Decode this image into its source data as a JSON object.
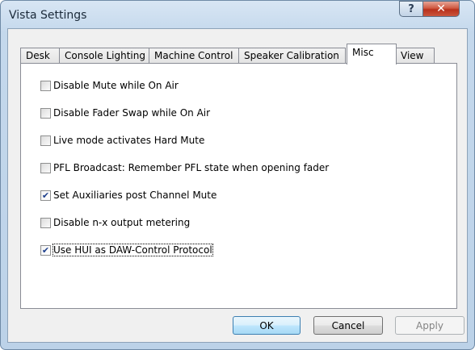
{
  "window": {
    "title": "Vista Settings",
    "help_label": "?",
    "close_label": "✕"
  },
  "tabs": [
    {
      "label": "Desk"
    },
    {
      "label": "Console Lighting"
    },
    {
      "label": "Machine Control"
    },
    {
      "label": "Speaker Calibration"
    },
    {
      "label": "Misc"
    },
    {
      "label": "View"
    }
  ],
  "active_tab": "Misc",
  "options": [
    {
      "label": "Disable Mute while On Air",
      "checked": false
    },
    {
      "label": "Disable Fader Swap while On Air",
      "checked": false
    },
    {
      "label": "Live mode activates Hard Mute",
      "checked": false
    },
    {
      "label": "PFL Broadcast: Remember PFL state when opening fader",
      "checked": false
    },
    {
      "label": "Set Auxiliaries post Channel Mute",
      "checked": true
    },
    {
      "label": "Disable n-x output metering",
      "checked": false
    },
    {
      "label": "Use HUI as DAW-Control Protocol",
      "checked": true
    }
  ],
  "check_glyph": "✔",
  "buttons": {
    "ok": "OK",
    "cancel": "Cancel",
    "apply": "Apply"
  }
}
